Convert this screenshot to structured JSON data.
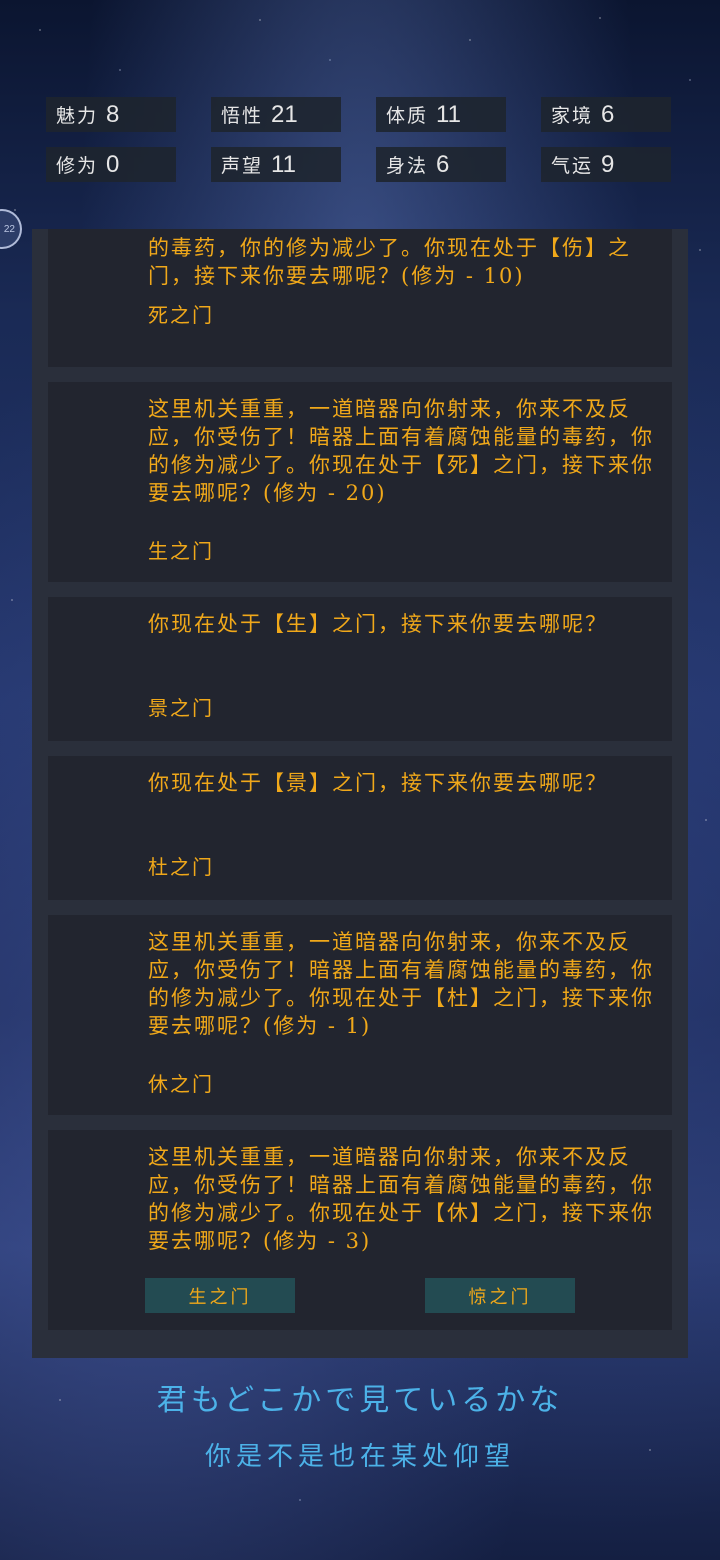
{
  "stats": [
    {
      "label": "魅力",
      "value": "8"
    },
    {
      "label": "悟性",
      "value": "21"
    },
    {
      "label": "体质",
      "value": "11"
    },
    {
      "label": "家境",
      "value": "6"
    },
    {
      "label": "修为",
      "value": "0"
    },
    {
      "label": "声望",
      "value": "11"
    },
    {
      "label": "身法",
      "value": "6"
    },
    {
      "label": "气运",
      "value": "9"
    }
  ],
  "side_badge": "22",
  "log": [
    {
      "text": "的毒药，你的修为减少了。你现在处于【伤】之门，接下来你要去哪呢？(修为 - 10)",
      "choice": "死之门"
    },
    {
      "text": "这里机关重重，一道暗器向你射来，你来不及反应，你受伤了！暗器上面有着腐蚀能量的毒药，你的修为减少了。你现在处于【死】之门，接下来你要去哪呢？(修为 - 20)",
      "choice": "生之门"
    },
    {
      "text": "你现在处于【生】之门，接下来你要去哪呢？",
      "choice": "景之门"
    },
    {
      "text": "你现在处于【景】之门，接下来你要去哪呢？",
      "choice": "杜之门"
    },
    {
      "text": "这里机关重重，一道暗器向你射来，你来不及反应，你受伤了！暗器上面有着腐蚀能量的毒药，你的修为减少了。你现在处于【杜】之门，接下来你要去哪呢？(修为 - 1)",
      "choice": "休之门"
    },
    {
      "text": "这里机关重重，一道暗器向你射来，你来不及反应，你受伤了！暗器上面有着腐蚀能量的毒药，你的修为减少了。你现在处于【休】之门，接下来你要去哪呢？(修为 - 3)"
    }
  ],
  "choices": [
    "生之门",
    "惊之门"
  ],
  "lyrics": {
    "line1": "君もどこかで見ているかな",
    "line2": "你是不是也在某处仰望"
  },
  "colors": {
    "text_gold": "#f0a81a",
    "card_bg": "#22252f",
    "panel_bg": "#2a2f3b",
    "button_bg": "#234b52",
    "lyric_blue": "#4cb2e8"
  }
}
